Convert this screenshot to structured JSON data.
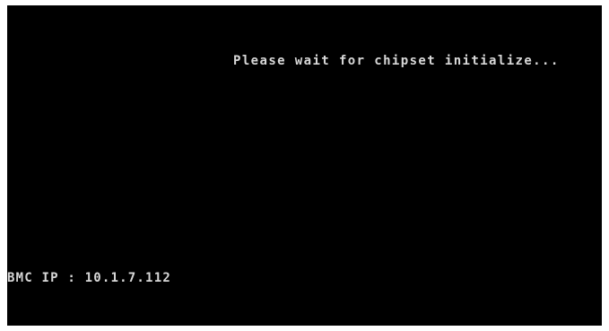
{
  "screen": {
    "background_color": "#000000",
    "text_color": "#d8d8d8",
    "status_message": "Please wait for chipset initialize...",
    "bmc_ip_line": "BMC IP : 10.1.7.112"
  }
}
